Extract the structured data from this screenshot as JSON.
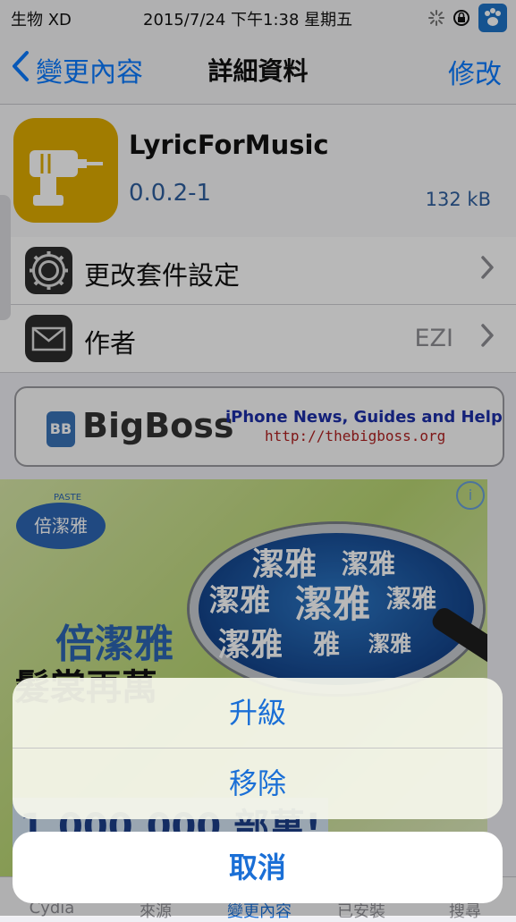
{
  "status_bar": {
    "carrier": "生物 XD",
    "datetime": "2015/7/24 下午1:38 星期五",
    "icons": [
      "link-icon",
      "spinner-icon",
      "rotation-lock-icon",
      "paw-icon"
    ]
  },
  "nav": {
    "back_label": "變更內容",
    "title": "詳細資料",
    "edit_label": "修改"
  },
  "package": {
    "name": "LyricForMusic",
    "version": "0.0.2-1",
    "size": "132 kB",
    "icon": "drill-icon",
    "icon_color": "#e0ac00"
  },
  "rows": [
    {
      "label": "更改套件設定",
      "value": "",
      "icon": "gear-icon"
    },
    {
      "label": "作者",
      "value": "EZI",
      "icon": "mail-icon"
    }
  ],
  "banner": {
    "icon_text": "BB",
    "name": "BigBoss",
    "tagline": "iPhone News, Guides and Help",
    "url": "http://thebigboss.org"
  },
  "ad": {
    "logo_small": "PASTE",
    "logo_text": "倍潔雅",
    "brand": "倍潔雅",
    "headline": "髮裳再萬",
    "number": "1,000,000 部萬!",
    "lens_words": [
      "潔雅",
      "潔雅",
      "潔雅",
      "潔雅",
      "潔雅",
      "潔雅",
      "雅",
      "潔雅"
    ],
    "info_icon": "info-icon"
  },
  "tabs": [
    "Cydia",
    "來源",
    "變更內容",
    "已安裝",
    "搜尋"
  ],
  "action_sheet": {
    "upgrade_label": "升級",
    "remove_label": "移除",
    "cancel_label": "取消"
  },
  "colors": {
    "accent": "#1a6fd6",
    "nav_blue": "#0a7bff",
    "version_blue": "#2f5f9e"
  }
}
